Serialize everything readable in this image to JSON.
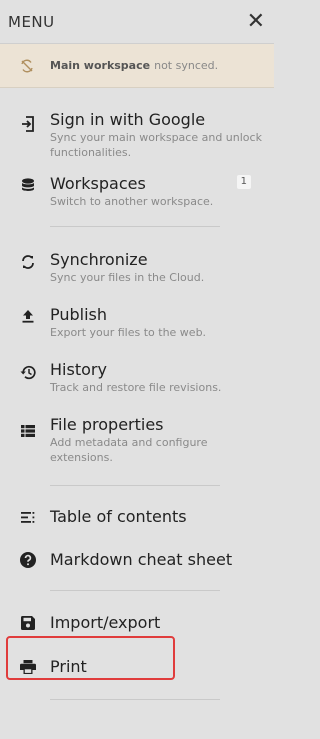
{
  "header": {
    "title": "MENU",
    "close_icon": "close-icon"
  },
  "banner": {
    "bold": "Main workspace",
    "rest": "not synced.",
    "icon": "sync-off-icon"
  },
  "items": [
    {
      "label": "Sign in with Google",
      "desc": "Sync your main workspace and unlock functionalities.",
      "icon": "login-icon"
    },
    {
      "label": "Workspaces",
      "desc": "Switch to another workspace.",
      "icon": "database-icon",
      "badge": "1"
    },
    {
      "label": "Synchronize",
      "desc": "Sync your files in the Cloud.",
      "icon": "sync-icon"
    },
    {
      "label": "Publish",
      "desc": "Export your files to the web.",
      "icon": "upload-icon"
    },
    {
      "label": "History",
      "desc": "Track and restore file revisions.",
      "icon": "history-icon"
    },
    {
      "label": "File properties",
      "desc": "Add metadata and configure extensions.",
      "icon": "list-icon"
    },
    {
      "label": "Table of contents",
      "icon": "toc-icon"
    },
    {
      "label": "Markdown cheat sheet",
      "icon": "help-icon"
    },
    {
      "label": "Import/export",
      "icon": "save-icon"
    },
    {
      "label": "Print",
      "icon": "print-icon"
    }
  ],
  "colors": {
    "highlight": "#e03c3c",
    "banner_bg": "#ece3d5",
    "panel_bg": "#e1e1e1"
  }
}
